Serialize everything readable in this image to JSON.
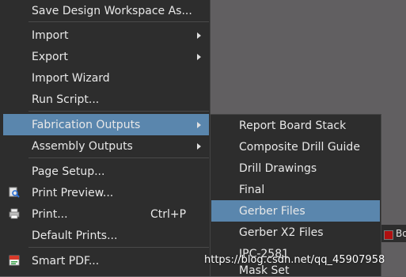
{
  "file_menu": {
    "items": [
      {
        "label": "Save Design Workspace As...",
        "shortcut": "",
        "has_submenu": false,
        "icon": ""
      },
      {
        "label": "Import",
        "shortcut": "",
        "has_submenu": true,
        "icon": ""
      },
      {
        "label": "Export",
        "shortcut": "",
        "has_submenu": true,
        "icon": ""
      },
      {
        "label": "Import Wizard",
        "shortcut": "",
        "has_submenu": false,
        "icon": ""
      },
      {
        "label": "Run Script...",
        "shortcut": "",
        "has_submenu": false,
        "icon": ""
      },
      {
        "label": "Fabrication Outputs",
        "shortcut": "",
        "has_submenu": true,
        "icon": "",
        "highlighted": true
      },
      {
        "label": "Assembly Outputs",
        "shortcut": "",
        "has_submenu": true,
        "icon": ""
      },
      {
        "label": "Page Setup...",
        "shortcut": "",
        "has_submenu": false,
        "icon": ""
      },
      {
        "label": "Print Preview...",
        "shortcut": "",
        "has_submenu": false,
        "icon": "print-preview-icon"
      },
      {
        "label": "Print...",
        "shortcut": "Ctrl+P",
        "has_submenu": false,
        "icon": "printer-icon"
      },
      {
        "label": "Default Prints...",
        "shortcut": "",
        "has_submenu": false,
        "icon": ""
      },
      {
        "label": "Smart PDF...",
        "shortcut": "",
        "has_submenu": false,
        "icon": "smart-pdf-icon"
      }
    ]
  },
  "fabrication_submenu": {
    "items": [
      {
        "label": "Report Board Stack"
      },
      {
        "label": "Composite Drill Guide"
      },
      {
        "label": "Drill Drawings"
      },
      {
        "label": "Final"
      },
      {
        "label": "Gerber Files",
        "highlighted": true
      },
      {
        "label": "Gerber X2 Files"
      },
      {
        "label": "IPC-2581"
      },
      {
        "label": "Mask Set"
      }
    ]
  },
  "right_panel": {
    "text": "Bo",
    "swatch_color": "#b01010"
  },
  "watermark": "https://blog.csdn.net/qq_45907958",
  "colors": {
    "menu_bg": "#2d2d2d",
    "highlight": "#5a86ad",
    "text": "#e8e8e8",
    "workspace": "#615f61"
  }
}
